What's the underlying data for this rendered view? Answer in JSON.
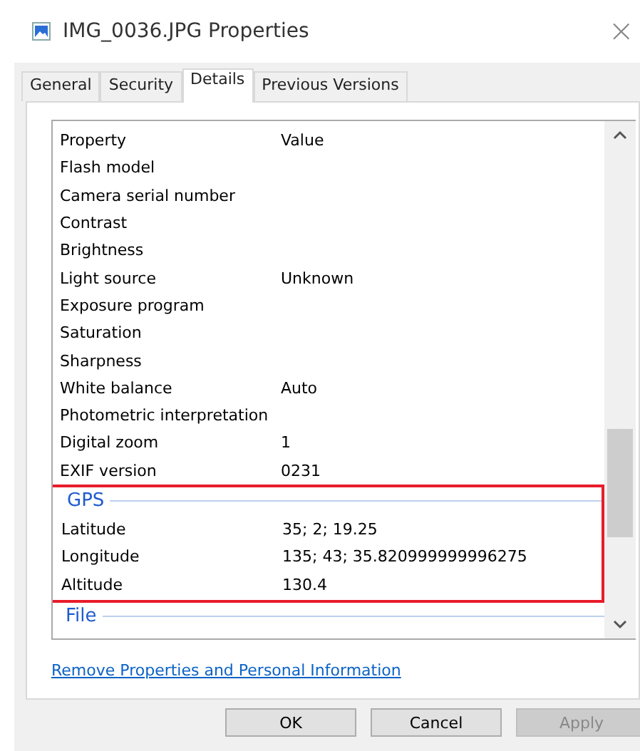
{
  "window": {
    "title": "IMG_0036.JPG Properties",
    "close": "×"
  },
  "tabs": [
    {
      "label": "General",
      "selected": false
    },
    {
      "label": "Security",
      "selected": false
    },
    {
      "label": "Details",
      "selected": true
    },
    {
      "label": "Previous Versions",
      "selected": false
    }
  ],
  "table": {
    "columns": [
      "Property",
      "Value"
    ],
    "sections": [
      {
        "highlighted": false,
        "rows": [
          {
            "property": "Flash model",
            "value": ""
          },
          {
            "property": "Camera serial number",
            "value": ""
          },
          {
            "property": "Contrast",
            "value": ""
          },
          {
            "property": "Brightness",
            "value": ""
          },
          {
            "property": "Light source",
            "value": "Unknown"
          },
          {
            "property": "Exposure program",
            "value": ""
          },
          {
            "property": "Saturation",
            "value": ""
          },
          {
            "property": "Sharpness",
            "value": ""
          },
          {
            "property": "White balance",
            "value": "Auto"
          },
          {
            "property": "Photometric interpretation",
            "value": ""
          },
          {
            "property": "Digital zoom",
            "value": "1"
          },
          {
            "property": "EXIF version",
            "value": "0231"
          }
        ]
      },
      {
        "title": "GPS",
        "highlighted": true,
        "rows": [
          {
            "property": "Latitude",
            "value": "35; 2; 19.25"
          },
          {
            "property": "Longitude",
            "value": "135; 43; 35.820999999996275"
          },
          {
            "property": "Altitude",
            "value": "130.4"
          }
        ]
      },
      {
        "title": "File",
        "highlighted": false
      }
    ]
  },
  "link": "Remove Properties and Personal Information",
  "buttons": [
    {
      "label": "OK",
      "disabled": false
    },
    {
      "label": "Cancel",
      "disabled": false
    },
    {
      "label": "Apply",
      "disabled": true
    }
  ]
}
